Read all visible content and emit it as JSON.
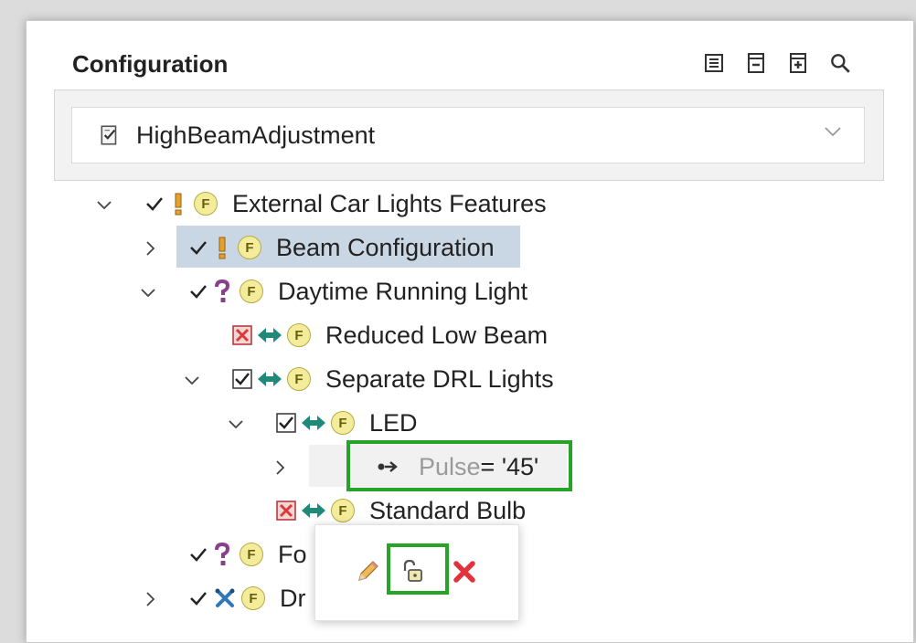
{
  "panel": {
    "title": "Configuration",
    "toolbar": [
      "properties-icon",
      "collapse-all-icon",
      "expand-all-icon",
      "search-icon"
    ]
  },
  "combo": {
    "value": "HighBeamAdjustment"
  },
  "tree": {
    "external": "External Car Lights Features",
    "beam": "Beam Configuration",
    "drl": "Daytime Running Light",
    "reduced": "Reduced Low Beam",
    "separate": "Separate DRL Lights",
    "led": "LED",
    "pulse_name": "Pulse",
    "pulse_eq": " = '45'",
    "standard": "Standard Bulb",
    "fo": "Fo",
    "dr": "Dr"
  },
  "feature_badge": "F",
  "popup": {
    "actions": [
      "edit-icon",
      "unlock-icon",
      "delete-icon"
    ]
  },
  "colors": {
    "highlight": "#27a327",
    "selection": "#c9d6e3",
    "feature": "#f3ec9a"
  }
}
